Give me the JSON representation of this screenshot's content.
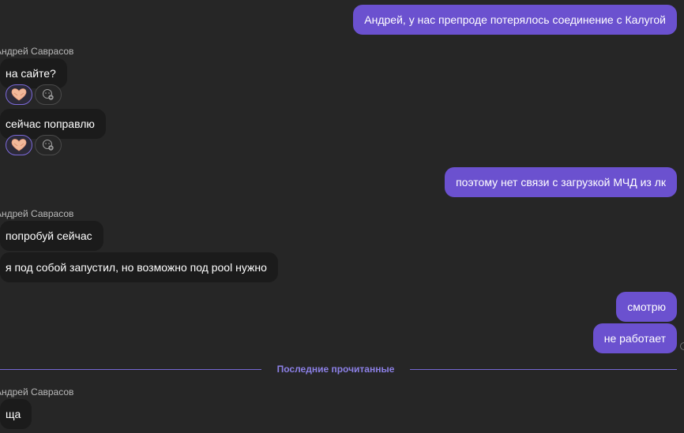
{
  "messages": {
    "m1": "Андрей, у нас препроде потерялось соединение с Калугой",
    "sender1": "Андрей Саврасов",
    "m2": "на сайте?",
    "m3": "сейчас поправлю",
    "m4": "поэтому нет связи с загрузкой МЧД из лк",
    "sender2": "Андрей Саврасов",
    "m5": "попробуй сейчас",
    "m6": "я под собой запустил, но возможно под pool нужно",
    "m7": "смотрю",
    "m8": "не работает",
    "sender3": "Андрей Саврасов",
    "m9": "ща"
  },
  "divider": {
    "label": "Последние прочитанные"
  },
  "reactions": {
    "emoji_name": "heart-hands-icon",
    "add_name": "add-reaction-icon"
  },
  "colors": {
    "background": "#262626",
    "outgoing_bubble": "#6b51cf",
    "incoming_bubble": "#1b1b1b",
    "accent": "#7467d4"
  }
}
